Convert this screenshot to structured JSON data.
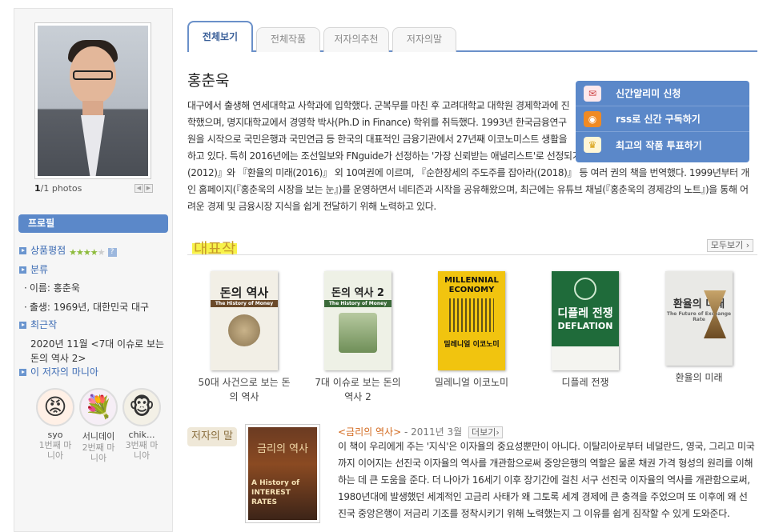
{
  "sidebar": {
    "photo_count_current": "1",
    "photo_count_rest": "/1 photos",
    "profile_heading": "프로필",
    "rating_label": "상품평점",
    "rating_stars": 4,
    "category_label": "분류",
    "name_line": "이름:  홍춘욱",
    "birth_line": "출생:  1969년, 대한민국 대구",
    "recent_label": "최근작",
    "recent_text": "2020년 11월 <7대 이슈로 보는 돈의 역사 2>",
    "mania_label": "이 저자의 마니아",
    "manias": [
      {
        "name": "syo",
        "rank": "1번째 마니아",
        "emoji": "😡"
      },
      {
        "name": "서니데이",
        "rank": "2번째 마니아",
        "emoji": "💐"
      },
      {
        "name": "chik...",
        "rank": "3번째 마니아",
        "emoji": "🐵"
      }
    ]
  },
  "tabs": [
    "전체보기",
    "전체작품",
    "저자의추천",
    "저자의말"
  ],
  "author": {
    "name": "홍춘욱",
    "bio": "대구에서 출생해 연세대학교 사학과에 입학했다. 군복무를 마친 후 고려대학교 대학원 경제학과에 진학했으며, 명지대학교에서 경영학 박사(Ph.D in Finance) 학위를 취득했다. 1993년 한국금융연구원을 시작으로 국민은행과 국민연금 등 한국의 대표적인 금융기관에서 27년째 이코노미스트 생활을 하고 있다. 특히 2016년에는 조선일보와 FNguide가 선정하는 '가장 신뢰받는 애널리스트'로 선정되기도 했다. 지은 책으로는 『돈 좀 굴려봅시다(2012)』와 『환율의 미래(2016)』 외 10여권에 이르며, 『순한장세의 주도주를 잡아라((2018)』 등 여러 권의 책을 번역했다. 1999년부터 개인 홈페이지(『홍춘욱의 시장을 보는 눈』)를 운영하면서 네티즌과 시작을 공유해왔으며, 최근에는 유튜브 채널(『홍춘욱의 경제강의 노트』)을 통해 어려운 경제 및 금융시장 지식을 쉽게 전달하기 위해 노력하고 있다."
  },
  "subscribe": {
    "items": [
      {
        "label": "신간알리미 신청",
        "icon": "mail-heart-icon"
      },
      {
        "label": "rss로 신간 구독하기",
        "icon": "rss-icon"
      },
      {
        "label": "최고의 작품 투표하기",
        "icon": "crown-icon"
      }
    ]
  },
  "works": {
    "heading": "대표작",
    "more_label": "모두보기",
    "books": [
      {
        "title": "50대 사건으로 보는 돈의 역사",
        "cover_title": "돈의 역사",
        "cover_sub": "The History of Money",
        "bg": "#f2efe6",
        "fg": "#2a2a2a"
      },
      {
        "title": "7대 이슈로 보는 돈의 역사 2",
        "cover_title": "돈의 역사 2",
        "cover_sub": "The History of Money",
        "bg": "#eef1e6",
        "fg": "#2a2a2a"
      },
      {
        "title": "밀레니얼 이코노미",
        "cover_title": "MILLENNIAL ECONOMY",
        "cover_sub": "밀레니얼 이코노미",
        "bg": "#f1c40f",
        "fg": "#111"
      },
      {
        "title": "디플레 전쟁",
        "cover_title": "디플레 전쟁",
        "cover_sub": "DEFLATION",
        "bg": "#1f6b3a",
        "fg": "#ffffff"
      },
      {
        "title": "환율의 미래",
        "cover_title": "환율의 미래",
        "cover_sub": "The Future of Exchange Rate",
        "bg": "#e9e9e6",
        "fg": "#444"
      }
    ]
  },
  "saying": {
    "badge": "저자의 말",
    "book_title": "<금리의 역사>",
    "date": "- 2011년 3월",
    "more_label": "더보기",
    "cover_title": "금리의 역사",
    "cover_sub": "A History of INTEREST RATES",
    "text": "이 책이 우리에게 주는 '지식'은 이자율의 중요성뿐만이 아니다. 이탈리아로부터 네덜란드, 영국, 그리고 미국까지 이어지는 선진국 이자율의 역사를 개관함으로써 중앙은행의 역할은 물론 채권 가격 형성의 원리를 이해하는 데 큰 도움을 준다. 더 나아가 16세기 이후 장기간에 걸친 서구 선진국 이자율의 역사를 개관함으로써, 1980년대에 발생했던 세계적인 고금리 사태가 왜 그토록 세계 경제에 큰 충격을 주었으며 또 이후에 왜 선진국 중앙은행이 저금리 기조를 정착시키기 위해 노력했는지 그 이유를 쉽게 짐작할 수 있게 도와준다."
  }
}
